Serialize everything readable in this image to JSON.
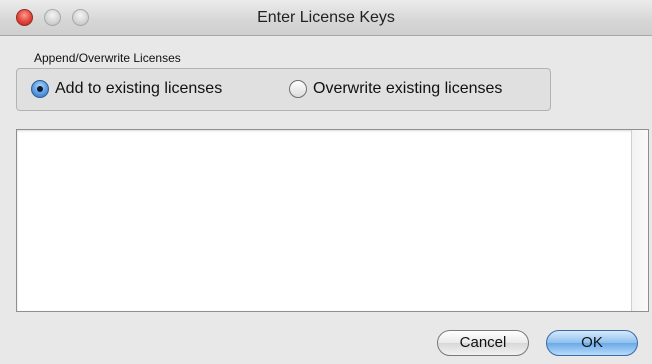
{
  "window": {
    "title": "Enter License Keys"
  },
  "append_group": {
    "label": "Append/Overwrite Licenses",
    "options": [
      {
        "label": "Add to existing licenses",
        "selected": true
      },
      {
        "label": "Overwrite existing licenses",
        "selected": false
      }
    ]
  },
  "license_input": {
    "value": ""
  },
  "buttons": {
    "cancel_label": "Cancel",
    "ok_label": "OK"
  },
  "icons": {
    "close": "close-traffic-light-icon",
    "minimize": "minimize-traffic-light-icon",
    "zoom": "zoom-traffic-light-icon"
  },
  "colors": {
    "close_red": "#e0443a",
    "default_button_blue": "#6aa9e8"
  }
}
